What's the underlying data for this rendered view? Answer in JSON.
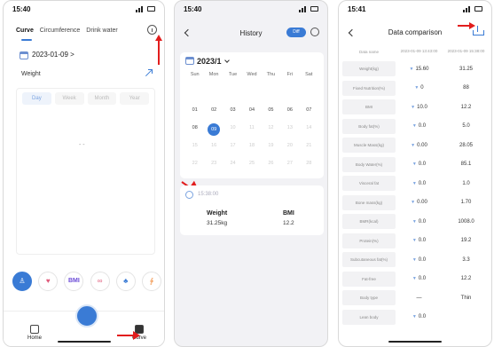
{
  "phone1": {
    "time": "15:40",
    "tabs": [
      "Curve",
      "Circumference",
      "Drink water"
    ],
    "date": "2023-01-09 >",
    "metric_label": "Weight",
    "periods": [
      "Day",
      "Week",
      "Month",
      "Year"
    ],
    "empty": "- -",
    "metric_icons": [
      "body-icon",
      "heart-rate-icon",
      "BMI",
      "fat-icon",
      "muscle-icon",
      "arm-icon"
    ],
    "bmi_text": "BMI",
    "nav": {
      "home": "Home",
      "curve": "Curve"
    }
  },
  "phone2": {
    "time": "15:40",
    "title": "History",
    "toggle": "Diff",
    "month": "2023/1",
    "weekdays": [
      "Sun",
      "Mon",
      "Tue",
      "Wed",
      "Thu",
      "Fri",
      "Sat"
    ],
    "days": [
      "01",
      "02",
      "03",
      "04",
      "05",
      "06",
      "07",
      "08",
      "09",
      "10",
      "11",
      "12",
      "13",
      "14",
      "15",
      "16",
      "17",
      "18",
      "19",
      "20",
      "21",
      "22",
      "23",
      "24",
      "25",
      "26",
      "27",
      "28"
    ],
    "selected_day": "09",
    "record": {
      "time": "15:38:00",
      "k1": "Weight",
      "v1": "31.25kg",
      "k2": "BMI",
      "v2": "12.2"
    }
  },
  "phone3": {
    "time": "15:41",
    "title": "Data comparison",
    "header": {
      "name": "Data name",
      "a": "2023-01-09 13:43:00",
      "b": "2023-01-09 15:38:00"
    },
    "rows": [
      {
        "name": "Weight(kg)",
        "a": "15.60",
        "b": "31.25"
      },
      {
        "name": "Fixed Nutrition(%)",
        "a": "0",
        "b": "88"
      },
      {
        "name": "BMI",
        "a": "10.0",
        "b": "12.2"
      },
      {
        "name": "Body fat(%)",
        "a": "0.0",
        "b": "5.0"
      },
      {
        "name": "Muscle Mass(kg)",
        "a": "0.00",
        "b": "28.05"
      },
      {
        "name": "Body Water(%)",
        "a": "0.0",
        "b": "85.1"
      },
      {
        "name": "Visceral fat",
        "a": "0.0",
        "b": "1.0"
      },
      {
        "name": "Bone mass(kg)",
        "a": "0.00",
        "b": "1.70"
      },
      {
        "name": "BMR(kcal)",
        "a": "0.0",
        "b": "1008.0"
      },
      {
        "name": "Protein(%)",
        "a": "0.0",
        "b": "19.2"
      },
      {
        "name": "Subcutaneous fat(%)",
        "a": "0.0",
        "b": "3.3"
      },
      {
        "name": "Fat-free",
        "a": "0.0",
        "b": "12.2"
      },
      {
        "name": "Body type",
        "a": "—",
        "b": "Thin"
      },
      {
        "name": "Lean body",
        "a": "0.0",
        "b": ""
      }
    ]
  },
  "colors": {
    "accent": "#3a7bd5",
    "annotation": "#e21d1d"
  }
}
